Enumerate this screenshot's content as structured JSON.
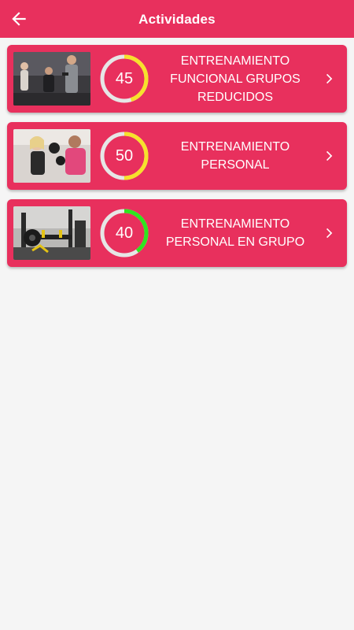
{
  "header": {
    "title": "Actividades",
    "back_icon": "arrow-left-icon",
    "background": "#e8305d"
  },
  "activities": [
    {
      "title": "ENTRENAMIENTO FUNCIONAL GRUPOS REDUCIDOS",
      "value": "45",
      "level_percent": 45,
      "ring_color": "#f7e12b",
      "image": "group training photo"
    },
    {
      "title": "ENTRENAMIENTO PERSONAL",
      "value": "50",
      "level_percent": 50,
      "ring_color": "#f7e12b",
      "image": "boxing personal trainer photo"
    },
    {
      "title": "ENTRENAMIENTO PERSONAL EN GRUPO",
      "value": "40",
      "level_percent": 40,
      "ring_color": "#2ee51e",
      "image": "gym equipment photo"
    }
  ],
  "colors": {
    "accent": "#e8305d",
    "ring_track": "#e6e6e6",
    "background": "#f5f5f5"
  }
}
